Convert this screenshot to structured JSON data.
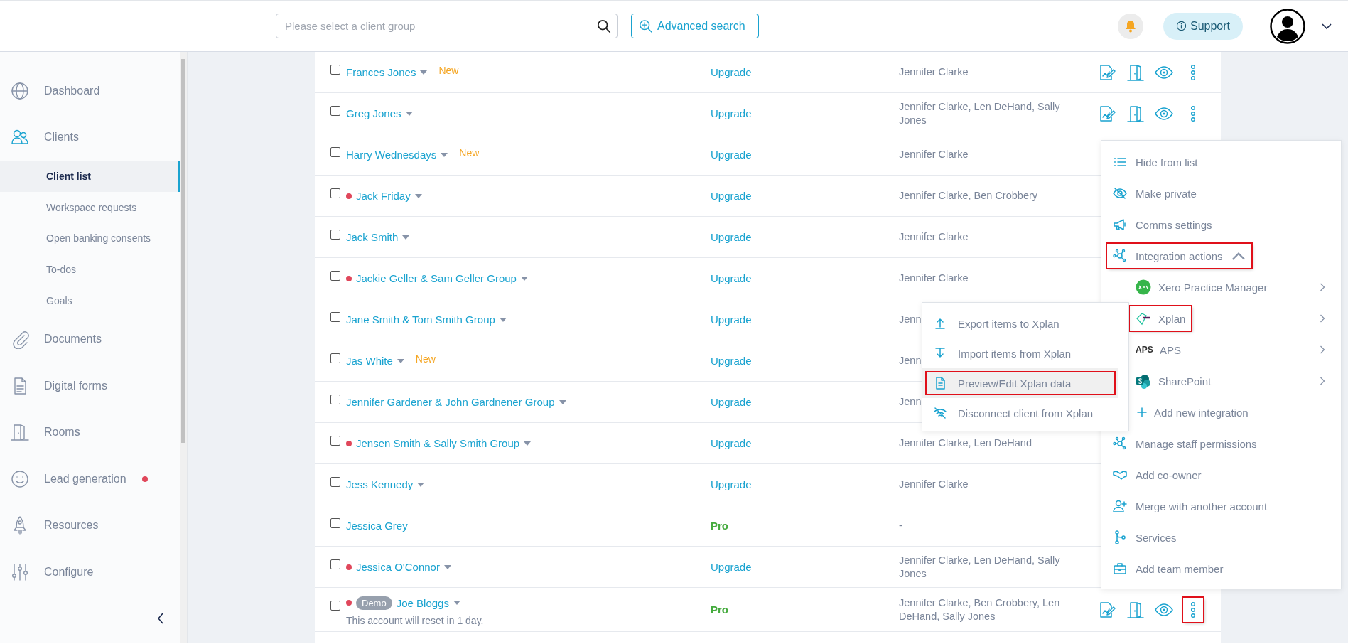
{
  "header": {
    "search": {
      "placeholder": "Please select a client group"
    },
    "advanced_search": "Advanced search",
    "support": "Support"
  },
  "sidebar": {
    "items": [
      {
        "label": "Dashboard",
        "selected": false,
        "dot": false
      },
      {
        "label": "Clients",
        "selected": true,
        "dot": false,
        "children": [
          {
            "label": "Client list",
            "selected": true
          },
          {
            "label": "Workspace requests",
            "selected": false
          },
          {
            "label": "Open banking consents",
            "selected": false
          },
          {
            "label": "To-dos",
            "selected": false
          },
          {
            "label": "Goals",
            "selected": false
          }
        ]
      },
      {
        "label": "Documents",
        "selected": false,
        "dot": false
      },
      {
        "label": "Digital forms",
        "selected": false,
        "dot": false
      },
      {
        "label": "Rooms",
        "selected": false,
        "dot": false
      },
      {
        "label": "Lead generation",
        "selected": false,
        "dot": true
      },
      {
        "label": "Resources",
        "selected": false,
        "dot": false
      },
      {
        "label": "Configure",
        "selected": false,
        "dot": false
      }
    ]
  },
  "table": {
    "rows": [
      {
        "checked": false,
        "dot": false,
        "name": "Frances Jones",
        "tag": "New",
        "plan": {
          "label": "Upgrade",
          "kind": "upgrade"
        },
        "owners": "Jennifer Clarke",
        "actions_visible": true,
        "more_highlighted": false
      },
      {
        "checked": false,
        "dot": false,
        "name": "Greg Jones",
        "plan": {
          "label": "Upgrade",
          "kind": "upgrade"
        },
        "owners": "Jennifer Clarke, Len DeHand, Sally Jones",
        "actions_visible": true,
        "more_highlighted": false
      },
      {
        "checked": false,
        "dot": false,
        "name": "Harry Wednesdays",
        "tag": "New",
        "plan": {
          "label": "Upgrade",
          "kind": "upgrade"
        },
        "owners": "Jennifer Clarke",
        "actions_visible": false
      },
      {
        "checked": false,
        "dot": true,
        "name": "Jack Friday",
        "plan": {
          "label": "Upgrade",
          "kind": "upgrade"
        },
        "owners": "Jennifer Clarke, Ben Crobbery",
        "actions_visible": false
      },
      {
        "checked": false,
        "dot": false,
        "name": "Jack Smith",
        "plan": {
          "label": "Upgrade",
          "kind": "upgrade"
        },
        "owners": "Jennifer Clarke",
        "actions_visible": false
      },
      {
        "checked": false,
        "dot": true,
        "name": "Jackie Geller & Sam Geller Group",
        "plan": {
          "label": "Upgrade",
          "kind": "upgrade"
        },
        "owners": "Jennifer Clarke",
        "actions_visible": false
      },
      {
        "checked": false,
        "dot": false,
        "name": "Jane Smith & Tom Smith Group",
        "plan": {
          "label": "Upgrade",
          "kind": "upgrade"
        },
        "owners": "Jenn",
        "actions_visible": false
      },
      {
        "checked": false,
        "dot": false,
        "name": "Jas White",
        "tag": "New",
        "plan": {
          "label": "Upgrade",
          "kind": "upgrade"
        },
        "owners": "Jenn",
        "actions_visible": false
      },
      {
        "checked": false,
        "dot": false,
        "name": "Jennifer Gardener & John Gardnener Group",
        "plan": {
          "label": "Upgrade",
          "kind": "upgrade"
        },
        "owners": "Jenn",
        "actions_visible": false
      },
      {
        "checked": false,
        "dot": true,
        "name": "Jensen Smith & Sally Smith Group",
        "plan": {
          "label": "Upgrade",
          "kind": "upgrade"
        },
        "owners": "Jennifer Clarke, Len DeHand",
        "actions_visible": false
      },
      {
        "checked": false,
        "dot": false,
        "name": "Jess Kennedy",
        "plan": {
          "label": "Upgrade",
          "kind": "upgrade"
        },
        "owners": "Jennifer Clarke",
        "actions_visible": false
      },
      {
        "checked": false,
        "dot": false,
        "name": "Jessica Grey",
        "no_caret": true,
        "plan": {
          "label": "Pro",
          "kind": "pro"
        },
        "owners": "-",
        "actions_visible": false
      },
      {
        "checked": false,
        "dot": true,
        "name": "Jessica O'Connor",
        "plan": {
          "label": "Upgrade",
          "kind": "upgrade"
        },
        "owners": "Jennifer Clarke, Len DeHand, Sally Jones",
        "actions_visible": false
      },
      {
        "checked": false,
        "dot": true,
        "badge": "Demo",
        "name": "Joe Bloggs",
        "note": "This account will reset in 1 day.",
        "plan": {
          "label": "Pro",
          "kind": "pro"
        },
        "owners": "Jennifer Clarke, Ben Crobbery, Len DeHand, Sally Jones",
        "actions_visible": true,
        "more_highlighted": true
      }
    ]
  },
  "context_menu": {
    "items": [
      {
        "label": "Hide from list",
        "highlighted": false
      },
      {
        "label": "Make private",
        "highlighted": false
      },
      {
        "label": "Comms settings",
        "highlighted": false
      },
      {
        "label": "Integration actions",
        "highlighted": true,
        "expanded": true,
        "children": [
          {
            "label": "Xero Practice Manager",
            "kind": "integration",
            "highlighted": false
          },
          {
            "label": "Xplan",
            "kind": "integration",
            "highlighted": true
          },
          {
            "label": "APS",
            "kind": "integration",
            "logo": "APS",
            "highlighted": false
          },
          {
            "label": "SharePoint",
            "kind": "integration",
            "highlighted": false
          },
          {
            "label": "Add new integration",
            "kind": "add",
            "highlighted": false
          }
        ]
      },
      {
        "label": "Manage staff permissions",
        "highlighted": false
      },
      {
        "label": "Add co-owner",
        "highlighted": false
      },
      {
        "label": "Merge with another account",
        "highlighted": false
      },
      {
        "label": "Services",
        "highlighted": false
      },
      {
        "label": "Add team member",
        "highlighted": false
      }
    ]
  },
  "submenu": {
    "items": [
      {
        "label": "Export items to Xplan",
        "selected": false,
        "highlighted": false
      },
      {
        "label": "Import items from Xplan",
        "selected": false,
        "highlighted": false
      },
      {
        "label": "Preview/Edit Xplan data",
        "selected": true,
        "highlighted": true
      },
      {
        "label": "Disconnect client from Xplan",
        "selected": false,
        "highlighted": false
      }
    ]
  }
}
